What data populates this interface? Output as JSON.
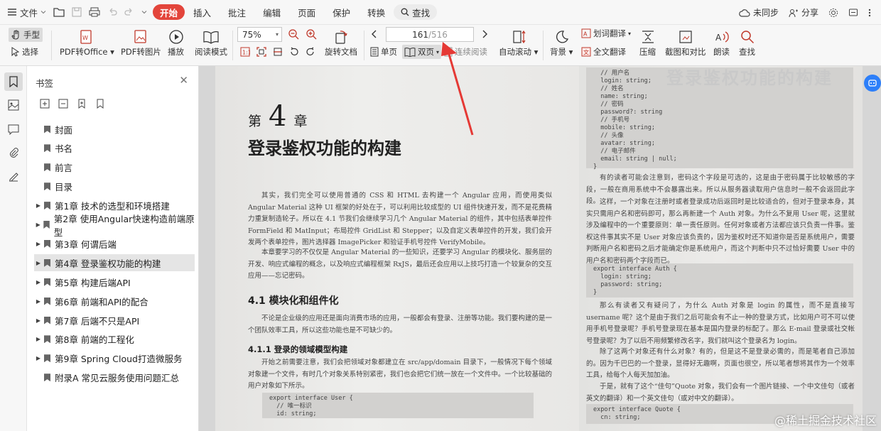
{
  "menu": {
    "file": "文件",
    "tabs": [
      "开始",
      "插入",
      "批注",
      "编辑",
      "页面",
      "保护",
      "转换"
    ],
    "search": "查找",
    "sync": "未同步",
    "share": "分享"
  },
  "toolbar": {
    "hand": "手型",
    "select": "选择",
    "pdf_to_office": "PDF转Office",
    "pdf_to_image": "PDF转图片",
    "play": "播放",
    "read_mode": "阅读模式",
    "zoom": "75%",
    "rotate": "旋转文档",
    "page_current": "161",
    "page_total": "/516",
    "single": "单页",
    "double": "双页",
    "continuous": "连续阅读",
    "auto_scroll": "自动滚动",
    "background": "背景",
    "word_translate": "划词翻译",
    "full_translate": "全文翻译",
    "compress": "压缩",
    "screenshot_compare": "截图和对比",
    "read_aloud": "朗读",
    "find": "查找"
  },
  "bookmarks": {
    "title": "书签",
    "items": [
      {
        "label": "封面",
        "exp": false
      },
      {
        "label": "书名",
        "exp": false
      },
      {
        "label": "前言",
        "exp": false
      },
      {
        "label": "目录",
        "exp": false
      },
      {
        "label": "第1章 技术的选型和环境搭建",
        "exp": true
      },
      {
        "label": "第2章 使用Angular快速构造前端原型",
        "exp": true
      },
      {
        "label": "第3章 何谓后端",
        "exp": true
      },
      {
        "label": "第4章 登录鉴权功能的构建",
        "exp": true
      },
      {
        "label": "第5章 构建后端API",
        "exp": true
      },
      {
        "label": "第6章 前端和API的配合",
        "exp": true
      },
      {
        "label": "第7章 后端不只是API",
        "exp": true
      },
      {
        "label": "第8章 前端的工程化",
        "exp": true
      },
      {
        "label": "第9章 Spring Cloud打造微服务",
        "exp": true
      },
      {
        "label": "附录A 常见云服务使用问题汇总",
        "exp": false
      }
    ]
  },
  "doc": {
    "ch_prefix": "第",
    "ch_num": "4",
    "ch_suffix": "章",
    "ch_title": "登录鉴权功能的构建",
    "para1": "其实，我们完全可以使用普通的 CSS 和 HTML 去构建一个 Angular 应用，而使用类似 Angular Material 这种 UI 框架的好处在于，可以利用比较成型的 UI 组件快速开发，而不是花费精力重复制造轮子。所以在 4.1 节我们会继续学习几个 Angular Material 的组件，其中包括表单控件 FormField 和 MatInput；布局控件 GridList 和 Stepper；以及自定义表单控件的开发，我们会开发两个表单控件，图片选择器 ImagePicker 和验证手机号控件 VerifyMobile。",
    "para2": "本章要学习的不仅仅是 Angular Material 的一些知识，还要学习 Angular 的模块化、服务层的开发、响应式编程的概念，以及响应式编程框架 RxJS，最后还会应用以上技巧打造一个较复杂的交互应用——忘记密码。",
    "h41": "4.1 模块化和组件化",
    "para3": "不论是企业级的应用还是面向消费市场的应用，一般都会有登录、注册等功能。我们要构建的是一个团队效率工具，所以这些功能也是不可缺少的。",
    "h411": "4.1.1 登录的领域模型构建",
    "para4": "开始之前需要注意，我们会把领域对象都建立在 src/app/domain 目录下，一般情况下每个领域对象建一个文件，有时几个对象关系特别紧密，我们也会把它们统一放在一个文件中。一个比较基础的用户对象如下所示。",
    "code1": "export interface User {\n  // 唯一标识\n  id: string;",
    "code_right1": "  // 用户名\n  login: string;\n  // 姓名\n  name: string;\n  // 密码\n  password?: string\n  // 手机号\n  mobile: string;\n  // 头像\n  avatar: string;\n  // 电子邮件\n  email: string | null;\n}",
    "rpara1": "有的读者可能会注意到，密码这个字段是可选的，这是由于密码属于比较敏感的字段，一般在商用系统中不会暴露出来。所以从服务器读取用户信息时一般不会返回此字段。",
    "rpara2": "这样，一个对象在注册时或者登录成功后返回时是比较适合的，但对于登录本身，其实只需用户名和密码即可，那么再新建一个 Auth 对象。为什么不复用 User 呢，这里就涉及编程中的一个重要原则：单一责任原则。任何对象或者方法都应该只负责一件事。鉴权这件事其实不是 User 对象应该负责的，因为鉴权时还不知道你是否是系统用户，需要判断用户名和密码之后才能确定你是系统用户，而这个判断中只不过恰好需要 User 中的用户名和密码两个字段而已。",
    "code_right2": "export interface Auth {\n  login: string;\n  password: string;\n}",
    "rpara3": "那么有读者又有疑问了，为什么 Auth 对象是 login 的属性，而不是直接写 username 呢？这个是由于我们之后可能会有不止一种的登录方式，比如用户可不可以使用手机号登录呢？手机号登录现在基本是国内登录的标配了。那么 E-mail 登录或社交帐号登录呢？为了以后不用频繁修改名字，我们就叫这个登录名为 login。",
    "rpara4": "除了这两个对象还有什么对象？有的，但是这不是登录必需的，而是笔者自己添加的。因为千巴巴的一个登录，显得好无趣啊，页面也很空，所以笔者想将其作为一个效率工具，给每个人每天加加油。",
    "rpara5": "于是，就有了这个“佳句”Quote 对象，我们会有一个图片链接、一个中文佳句（或者英文的翻译）和一个英文佳句（或对中文的翻译）。",
    "code_right3": "export interface Quote {\n  cn: string;",
    "ghost_title": "登录鉴权功能的构建"
  },
  "watermark": "@稀土掘金技术社区",
  "colors": {
    "accent": "#e3453b",
    "annotation_arrow": "#e53935",
    "fab": "#2d7ff9"
  }
}
